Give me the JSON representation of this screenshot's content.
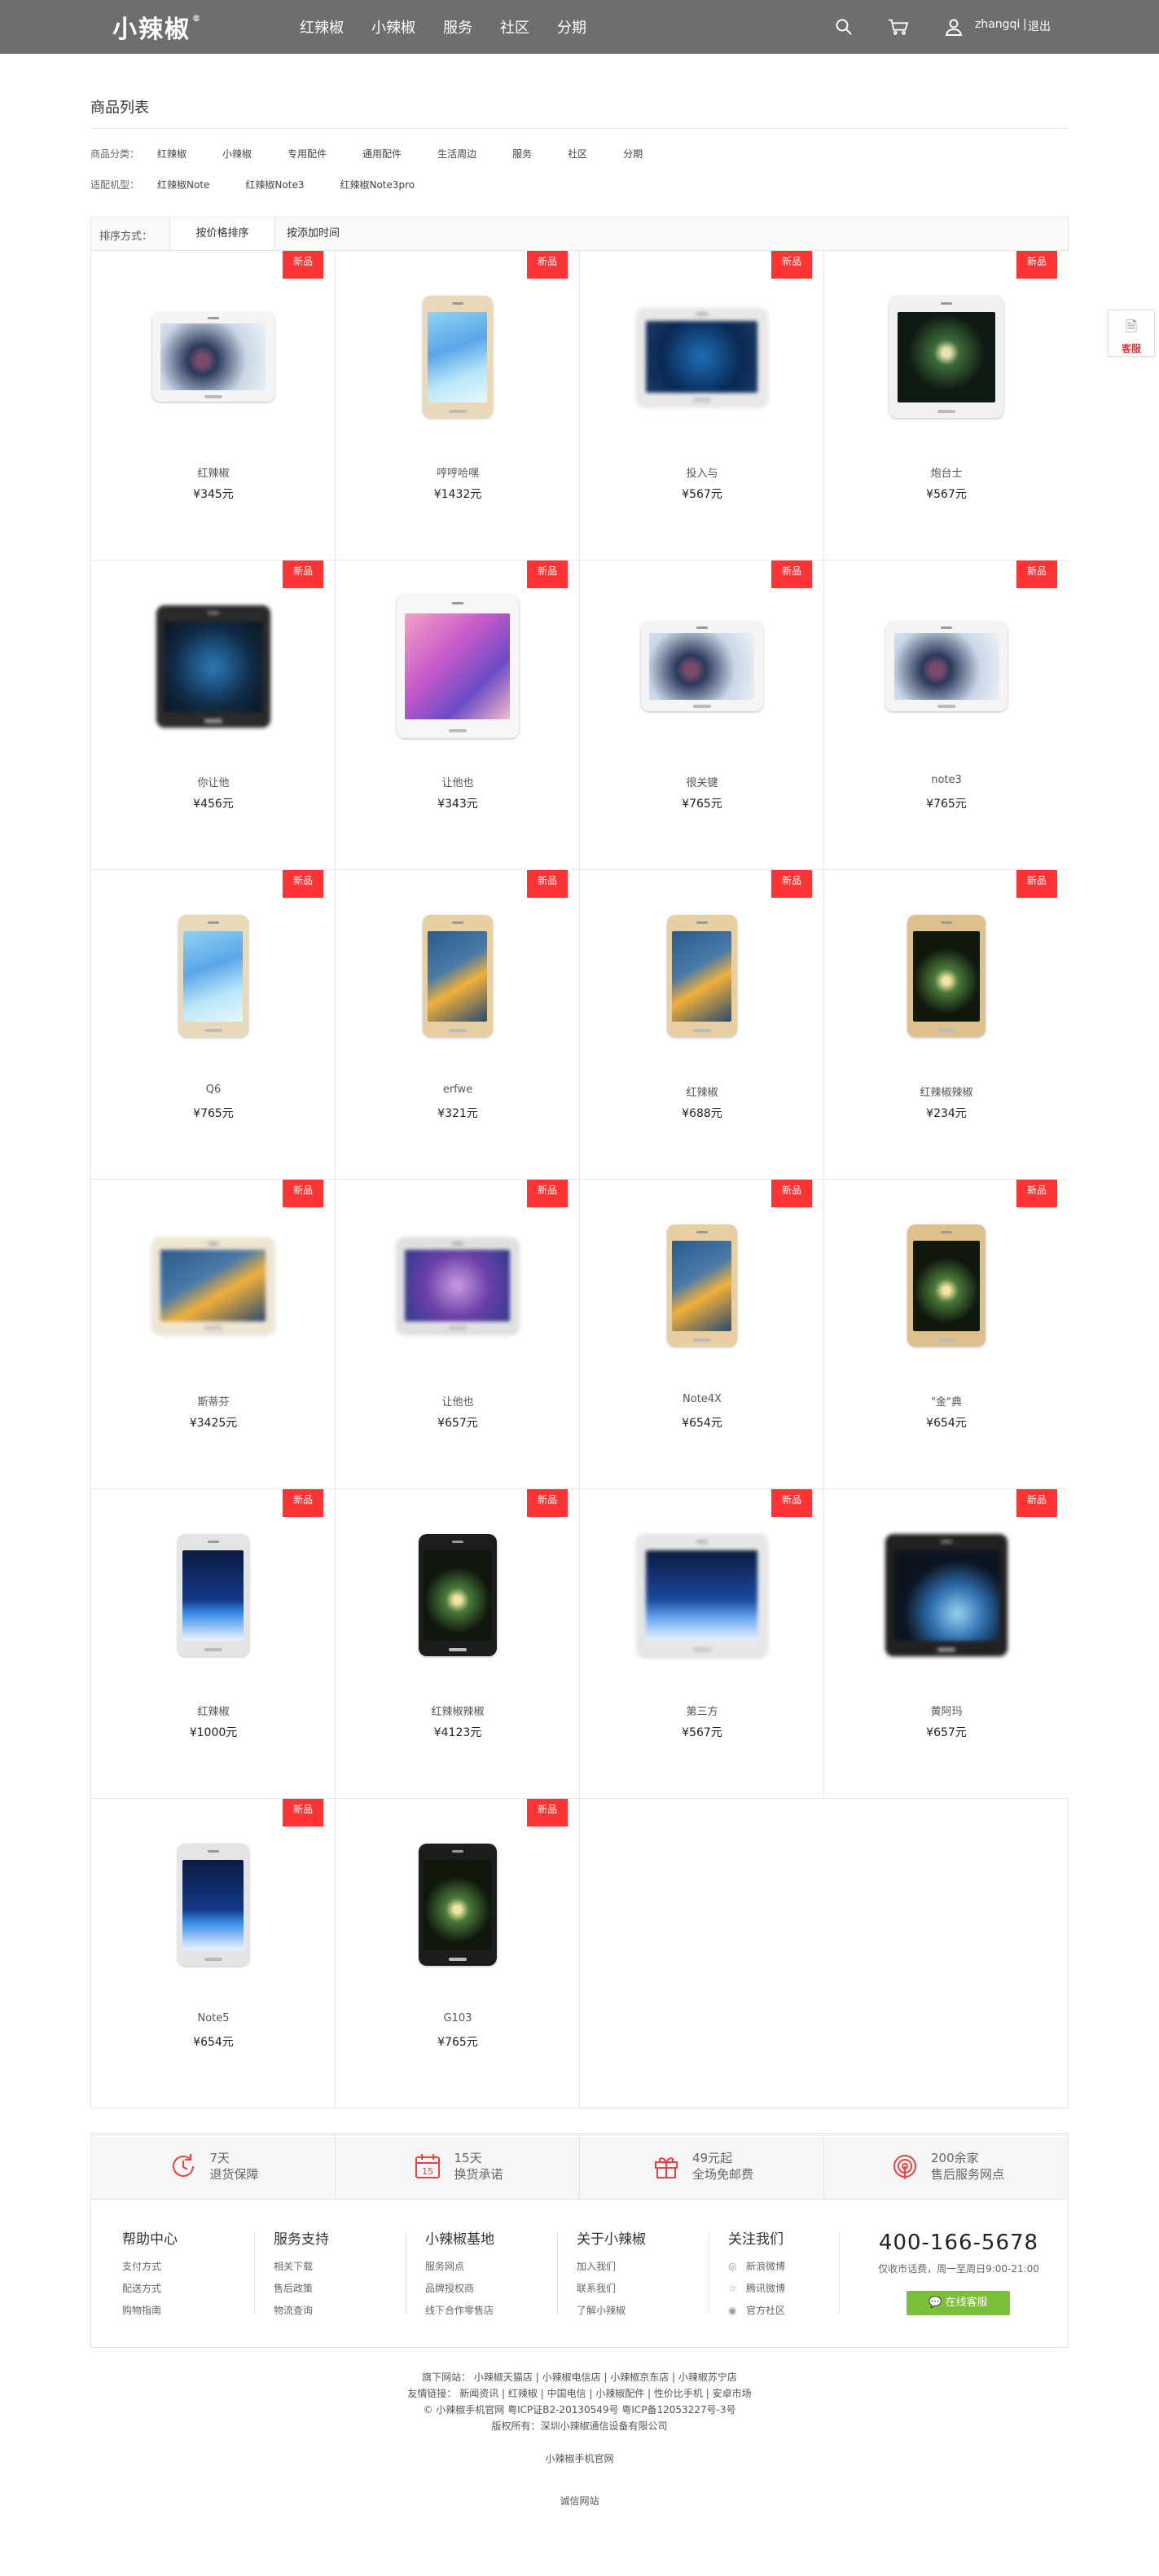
{
  "header": {
    "logo": "小辣椒",
    "nav": [
      "红辣椒",
      "小辣椒",
      "服务",
      "社区",
      "分期"
    ],
    "username": "zhangqi",
    "separator": "|",
    "logout": "退出"
  },
  "list": {
    "title": "商品列表",
    "category_label": "商品分类：",
    "categories": [
      "红辣椒",
      "小辣椒",
      "专用配件",
      "通用配件",
      "生活周边",
      "服务",
      "社区",
      "分期"
    ],
    "model_label": "适配机型：",
    "models": [
      "红辣椒Note",
      "红辣椒Note3",
      "红辣椒Note3pro"
    ],
    "sort_label": "排序方式：",
    "sort_options": [
      "按价格排序",
      "按添加时间"
    ]
  },
  "badge_text": "新品",
  "products": [
    {
      "name": "红辣椒",
      "price": "¥345元",
      "style": "white-wide"
    },
    {
      "name": "哼哼哈嘿",
      "price": "¥1432元",
      "style": "gold-blue"
    },
    {
      "name": "投入与",
      "price": "¥567元",
      "style": "blur-blue"
    },
    {
      "name": "炮台士",
      "price": "¥567元",
      "style": "white-galaxy"
    },
    {
      "name": "你让他",
      "price": "¥456元",
      "style": "blur-dark"
    },
    {
      "name": "让他也",
      "price": "¥343元",
      "style": "white-pink"
    },
    {
      "name": "很关键",
      "price": "¥765元",
      "style": "white-wide"
    },
    {
      "name": "note3",
      "price": "¥765元",
      "style": "white-wide"
    },
    {
      "name": "Q6",
      "price": "¥765元",
      "style": "gold-blue"
    },
    {
      "name": "erfwe",
      "price": "¥321元",
      "style": "gold-bird"
    },
    {
      "name": "红辣椒",
      "price": "¥688元",
      "style": "gold-bird"
    },
    {
      "name": "红辣椒辣椒",
      "price": "¥234元",
      "style": "gold-galaxy"
    },
    {
      "name": "斯蒂芬",
      "price": "¥3425元",
      "style": "blur-bird"
    },
    {
      "name": "让他也",
      "price": "¥657元",
      "style": "blur-purple"
    },
    {
      "name": "Note4X",
      "price": "¥654元",
      "style": "gold-bird"
    },
    {
      "name": "\"金\"典",
      "price": "¥654元",
      "style": "gold-galaxy"
    },
    {
      "name": "红辣椒",
      "price": "¥1000元",
      "style": "silver-1851"
    },
    {
      "name": "红辣椒辣椒",
      "price": "¥4123元",
      "style": "black-galaxy"
    },
    {
      "name": "第三方",
      "price": "¥567元",
      "style": "blur-silver"
    },
    {
      "name": "黄阿玛",
      "price": "¥657元",
      "style": "blur-earth"
    },
    {
      "name": "Note5",
      "price": "¥654元",
      "style": "silver-1851"
    },
    {
      "name": "G103",
      "price": "¥765元",
      "style": "black-galaxy"
    }
  ],
  "services": [
    {
      "line1": "7天",
      "line2": "退货保障",
      "icon": "return-clock-icon"
    },
    {
      "line1": "15天",
      "line2": "换货承诺",
      "icon": "calendar-icon"
    },
    {
      "line1": "49元起",
      "line2": "全场免邮费",
      "icon": "gift-icon"
    },
    {
      "line1": "200余家",
      "line2": "售后服务网点",
      "icon": "service-signal-icon"
    }
  ],
  "footer": {
    "columns": [
      {
        "title": "帮助中心",
        "items": [
          "支付方式",
          "配送方式",
          "购物指南"
        ]
      },
      {
        "title": "服务支持",
        "items": [
          "相关下载",
          "售后政策",
          "物流查询"
        ]
      },
      {
        "title": "小辣椒基地",
        "items": [
          "服务网点",
          "品牌授权商",
          "线下合作零售店"
        ]
      },
      {
        "title": "关于小辣椒",
        "items": [
          "加入我们",
          "联系我们",
          "了解小辣椒"
        ]
      },
      {
        "title": "关注我们",
        "items": [
          "新浪微博",
          "腾讯微博",
          "官方社区"
        ]
      }
    ],
    "hotline": "400-166-5678",
    "hours": "仅收市话费，周一至周日9:00-21:00",
    "chat_button": "在线客服"
  },
  "bottom": {
    "line1": "旗下网站：  小辣椒天猫店  |  小辣椒电信店  |  小辣椒京东店  |  小辣椒苏宁店",
    "line2": "友情链接：  新闻资讯  |  红辣椒  |  中国电信  |  小辣椒配件  |  性价比手机  |  安卓市场",
    "line3": "©  小辣椒手机官网  粤ICP证B2-20130549号 粤ICP备12053227号-3号",
    "line4": "版权所有：深圳小辣椒通信设备有限公司",
    "official": "小辣椒手机官网",
    "honest": "诚信网站"
  },
  "kefu": "客服",
  "colors": {
    "header_bg": "#6e6e6e",
    "badge": "#ff3333",
    "accent_red": "#ee4040",
    "chat_green": "#7bbf3a"
  }
}
